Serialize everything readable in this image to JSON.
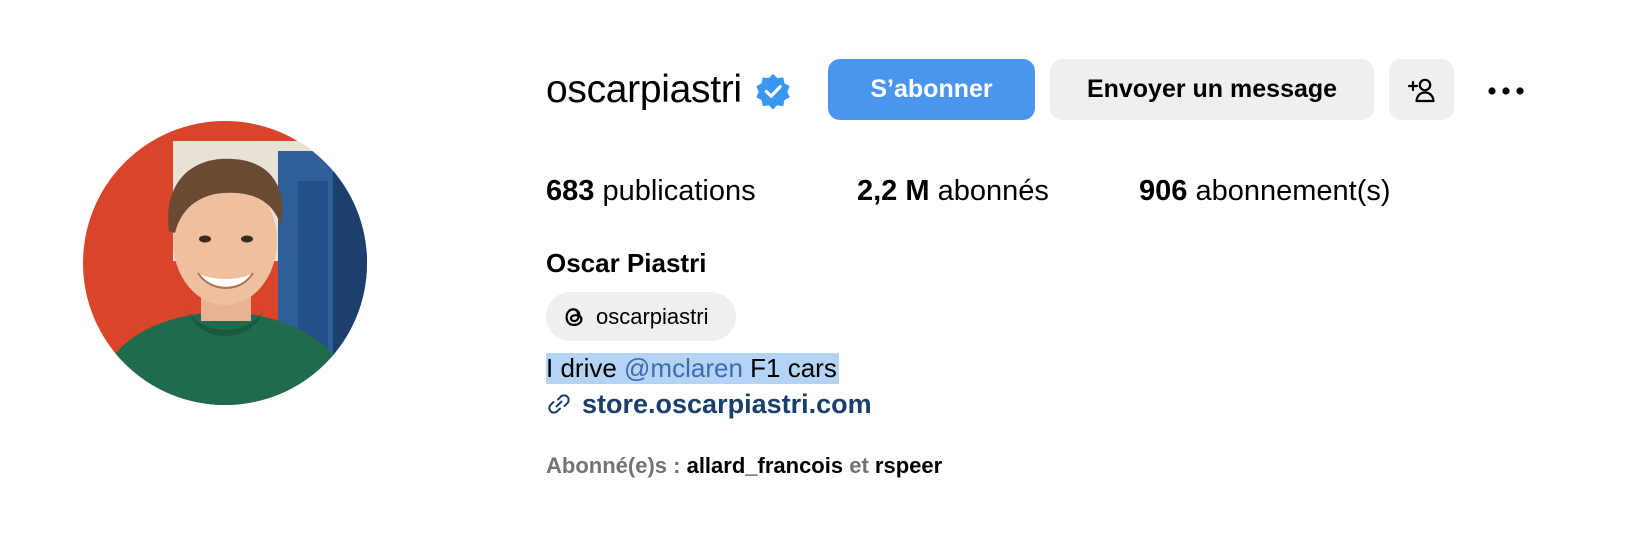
{
  "profile": {
    "username": "oscarpiastri",
    "verified_badge_icon": "verified-badge-icon",
    "full_name": "Oscar Piastri",
    "threads_handle": "oscarpiastri",
    "threads_icon": "threads-icon",
    "avatar_icon": "profile-photo"
  },
  "actions": {
    "follow_label": "S’abonner",
    "message_label": "Envoyer un message",
    "add_user_icon": "add-user-icon",
    "more_icon": "more-options-icon"
  },
  "stats": {
    "posts_count": "683",
    "posts_label": "publications",
    "followers_count": "2,2 M",
    "followers_label": "abonnés",
    "following_count": "906",
    "following_label": "abonnement(s)"
  },
  "bio": {
    "text_before": "I drive ",
    "mention": "@mclaren",
    "text_after": " F1 cars",
    "link_icon": "link-icon",
    "link": "store.oscarpiastri.com"
  },
  "followed_by": {
    "prefix": "Abonné(e)s :",
    "user1": "allard_francois",
    "conjunction": "et",
    "user2": "rspeer"
  },
  "colors": {
    "follow_button": "#4a96ef",
    "secondary_button": "#efefef",
    "verified": "#3897f0",
    "mention": "#3d6dae",
    "link": "#1a3f6b",
    "selection_highlight": "#b4d3f5"
  }
}
